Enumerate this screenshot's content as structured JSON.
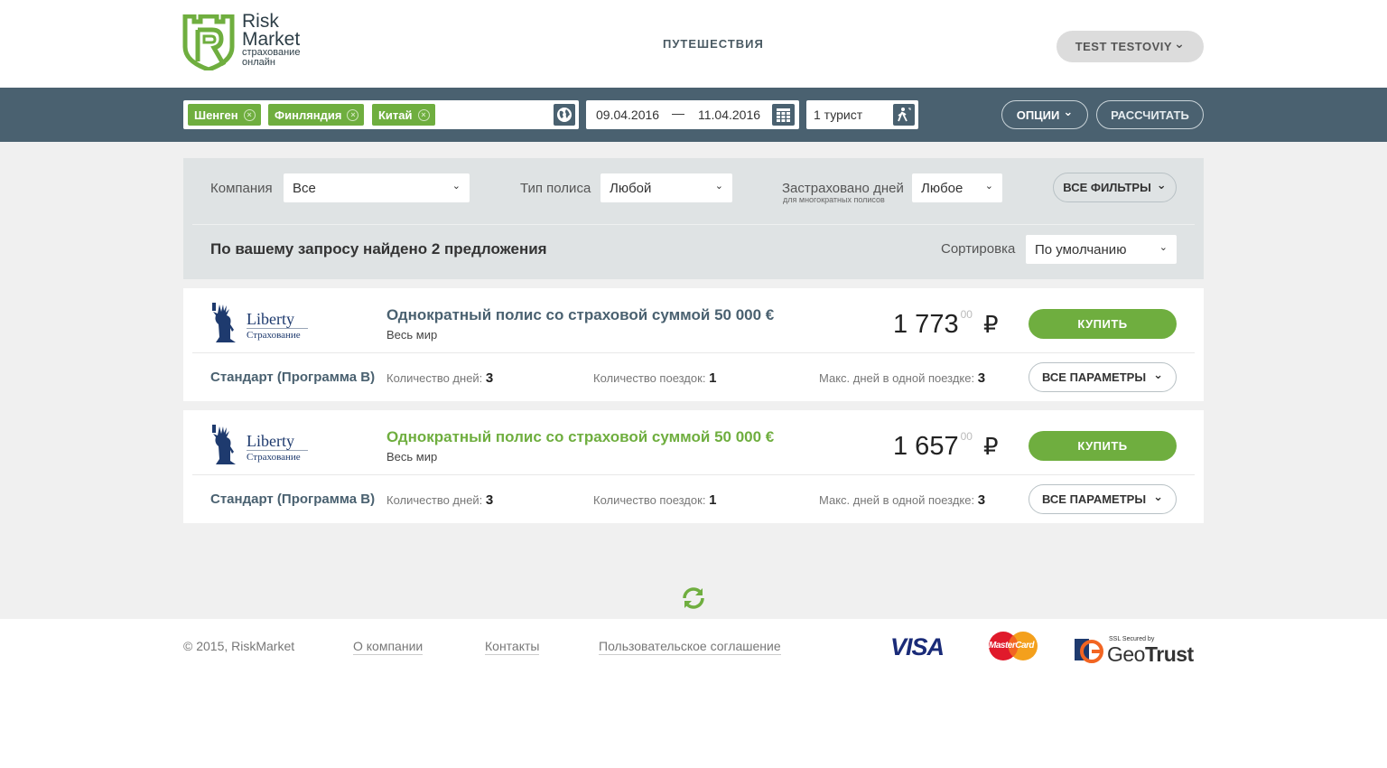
{
  "header": {
    "logo_line1": "Risk",
    "logo_line2": "Market",
    "logo_sub1": "страхование",
    "logo_sub2": "онлайн",
    "nav_travel": "ПУТЕШЕСТВИЯ",
    "user_name": "TEST TESTOVIY",
    "user_chevron": "⌄"
  },
  "search": {
    "tags": [
      "Шенген",
      "Финляндия",
      "Китай"
    ],
    "tag_remove_glyph": "×",
    "date_from": "09.04.2016",
    "date_sep": "—",
    "date_to": "11.04.2016",
    "tourists": "1 турист",
    "options_label": "ОПЦИИ",
    "options_chevron": "⌄",
    "calculate_label": "РАССЧИТАТЬ"
  },
  "filters": {
    "company_label": "Компания",
    "company_value": "Все",
    "policy_type_label": "Тип полиса",
    "policy_type_value": "Любой",
    "days_label": "Застраховано дней",
    "days_note": "для многократных полисов",
    "days_value": "Любое",
    "all_filters_label": "ВСЕ ФИЛЬТРЫ",
    "chevron": "⌄",
    "found_text": "По вашему запросу найдено 2 предложения",
    "sort_label": "Сортировка",
    "sort_value": "По умолчанию"
  },
  "offers": [
    {
      "insurer_name": "Liberty",
      "insurer_sub": "Страхование",
      "title": "Однократный полис со страховой суммой 50 000 €",
      "area": "Весь мир",
      "price_main": "1 773",
      "price_kop": "00",
      "currency": "₽",
      "buy_label": "КУПИТЬ",
      "program": "Стандарт (Программа В)",
      "days_label": "Количество дней:",
      "days_value": "3",
      "trips_label": "Количество поездок:",
      "trips_value": "1",
      "max_days_label": "Макс. дней в одной поездке:",
      "max_days_value": "3",
      "all_params_label": "ВСЕ ПАРАМЕТРЫ",
      "chevron": "⌄"
    },
    {
      "insurer_name": "Liberty",
      "insurer_sub": "Страхование",
      "title": "Однократный полис со страховой суммой 50 000 €",
      "area": "Весь мир",
      "price_main": "1 657",
      "price_kop": "00",
      "currency": "₽",
      "buy_label": "КУПИТЬ",
      "program": "Стандарт (Программа В)",
      "days_label": "Количество дней:",
      "days_value": "3",
      "trips_label": "Количество поездок:",
      "trips_value": "1",
      "max_days_label": "Макс. дней в одной поездке:",
      "max_days_value": "3",
      "all_params_label": "ВСЕ ПАРАМЕТРЫ",
      "chevron": "⌄"
    }
  ],
  "footer": {
    "copyright": "© 2015, RiskMarket",
    "about": "О компании",
    "contacts": "Контакты",
    "agreement": "Пользовательское соглашение",
    "visa": "VISA",
    "mastercard": "MasterCard",
    "geotrust_ssl": "SSL Secured by",
    "geotrust_geo": "Geo",
    "geotrust_trust": "Trust"
  },
  "colors": {
    "brand_green": "#6fae3f",
    "bar_slate": "#4a6170",
    "background_grey": "#f0f0f0"
  },
  "icons": [
    "globe-icon",
    "calendar-icon",
    "walker-icon",
    "chevron-down-icon",
    "tag-remove-icon",
    "refresh-icon"
  ]
}
